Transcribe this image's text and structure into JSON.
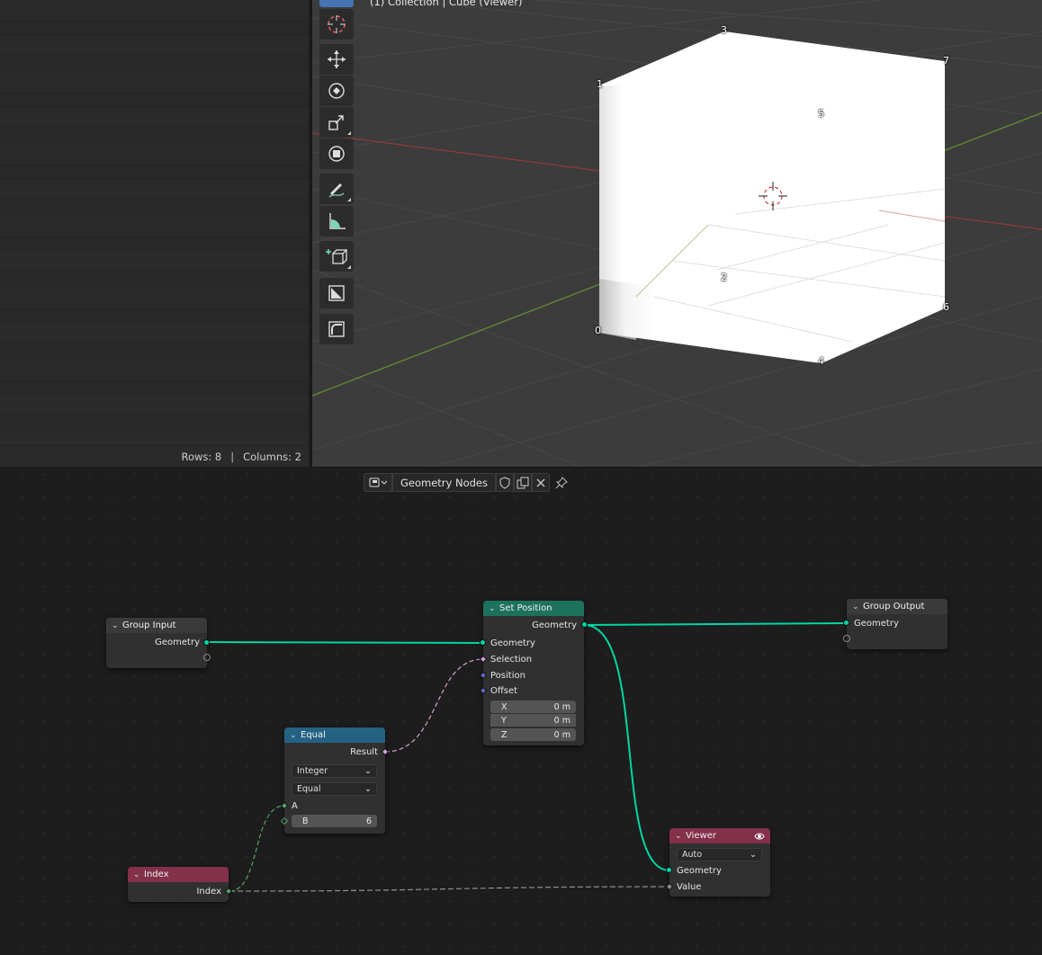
{
  "spreadsheet": {
    "rows_label": "Rows: 8",
    "columns_label": "Columns: 2"
  },
  "viewport": {
    "header": "(1) Collection | Cube (Viewer)",
    "vertex_labels": [
      "0",
      "1",
      "2",
      "3",
      "4",
      "5",
      "6",
      "7"
    ],
    "tools": [
      "cursor-icon",
      "move-icon",
      "rotate-icon",
      "scale-icon",
      "transform-icon",
      "annotate-icon",
      "measure-icon",
      "add-cube-icon",
      "extrude-icon",
      "bevel-icon"
    ]
  },
  "node_editor": {
    "tree_name": "Geometry Nodes",
    "colors": {
      "geometry_socket": "#00d6a3",
      "geometry_node": "#1d725e",
      "input_node": "#83314a",
      "function_node": "#246283",
      "output_node": "#83314a"
    },
    "nodes": {
      "group_input": {
        "title": "Group Input",
        "outputs": [
          "Geometry"
        ]
      },
      "group_output": {
        "title": "Group Output",
        "inputs": [
          "Geometry"
        ]
      },
      "set_position": {
        "title": "Set Position",
        "output": "Geometry",
        "inputs": [
          "Geometry",
          "Selection",
          "Position",
          "Offset"
        ],
        "offset": [
          {
            "axis": "X",
            "value": "0 m"
          },
          {
            "axis": "Y",
            "value": "0 m"
          },
          {
            "axis": "Z",
            "value": "0 m"
          }
        ]
      },
      "equal": {
        "title": "Equal",
        "output": "Result",
        "data_type": "Integer",
        "mode": "Equal",
        "input_a": "A",
        "input_b_label": "B",
        "input_b_value": "6"
      },
      "index": {
        "title": "Index",
        "output": "Index"
      },
      "viewer": {
        "title": "Viewer",
        "domain": "Auto",
        "inputs": [
          "Geometry",
          "Value"
        ]
      }
    }
  }
}
